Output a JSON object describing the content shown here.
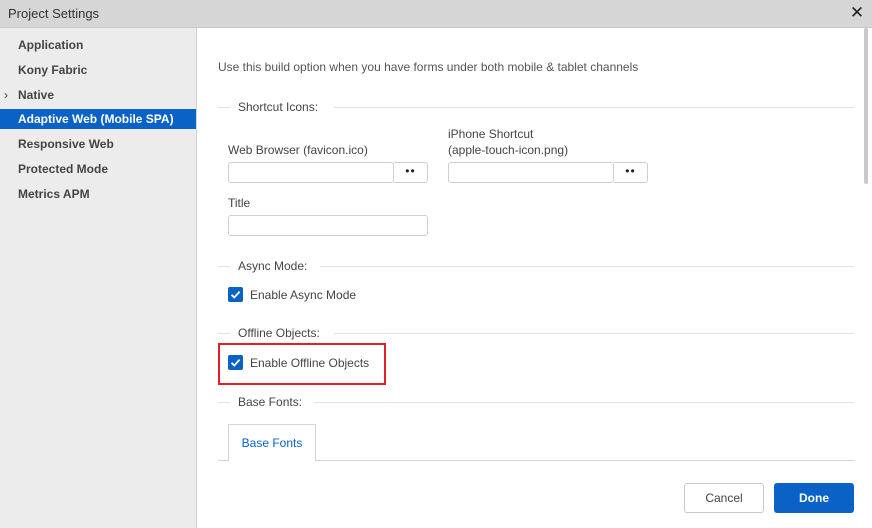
{
  "window": {
    "title": "Project Settings",
    "close_label": "✕"
  },
  "sidebar": {
    "items": [
      {
        "label": "Application"
      },
      {
        "label": "Kony Fabric"
      },
      {
        "label": "Native",
        "expander": "›"
      },
      {
        "label": "Adaptive Web (Mobile SPA)",
        "active": true
      },
      {
        "label": "Responsive Web"
      },
      {
        "label": "Protected Mode"
      },
      {
        "label": "Metrics APM"
      }
    ]
  },
  "main": {
    "description": "Use this build option when you have forms under both mobile & tablet channels",
    "shortcut_icons": {
      "heading": "Shortcut Icons:",
      "web_browser_label": "Web Browser (favicon.ico)",
      "web_browser_value": "",
      "iphone_label_line1": "iPhone Shortcut",
      "iphone_label_line2": "(apple-touch-icon.png)",
      "iphone_value": "",
      "browse_label": "••",
      "title_label": "Title",
      "title_value": ""
    },
    "async_mode": {
      "heading": "Async Mode:",
      "checkbox_label": "Enable Async Mode",
      "checked": true
    },
    "offline_objects": {
      "heading": "Offline Objects:",
      "checkbox_label": "Enable Offline Objects",
      "checked": true
    },
    "base_fonts": {
      "heading": "Base Fonts:",
      "tab_label": "Base Fonts"
    }
  },
  "footer": {
    "cancel_label": "Cancel",
    "done_label": "Done"
  },
  "colors": {
    "accent": "#0a62c6",
    "highlight": "#e0202a",
    "sidebar_bg": "#ececec",
    "titlebar_bg": "#d6d6d6"
  }
}
